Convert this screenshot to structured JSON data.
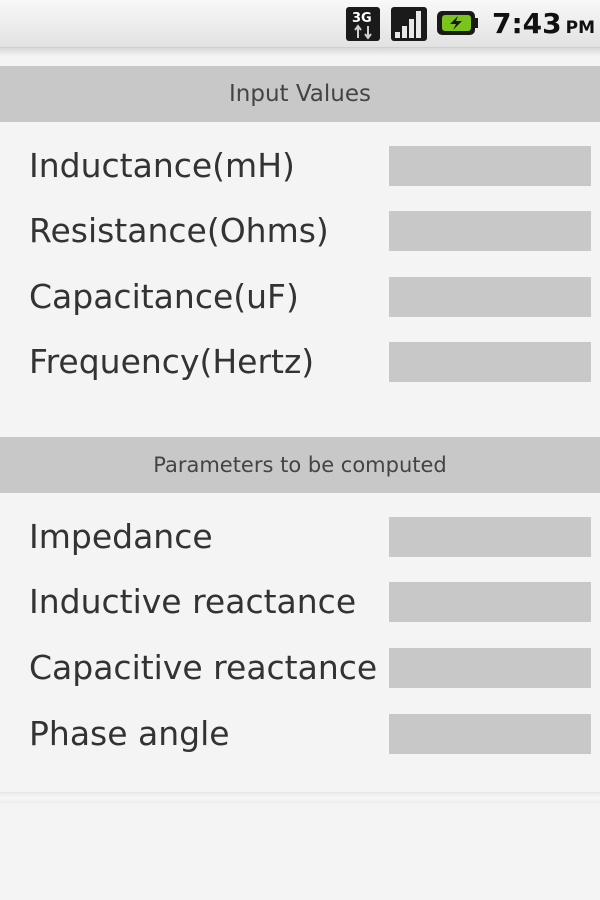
{
  "status_bar": {
    "network_icon": "3g-data-icon",
    "network_label": "3G",
    "signal_icon": "signal-strength-icon",
    "battery_icon": "battery-charging-icon",
    "time": "7:43",
    "ampm": "PM"
  },
  "input_section": {
    "title": "Input Values",
    "fields": [
      {
        "label": "Inductance(mH)",
        "value": ""
      },
      {
        "label": "Resistance(Ohms)",
        "value": ""
      },
      {
        "label": "Capacitance(uF)",
        "value": ""
      },
      {
        "label": "Frequency(Hertz)",
        "value": ""
      }
    ]
  },
  "output_section": {
    "title": "Parameters to be computed",
    "fields": [
      {
        "label": "Impedance",
        "value": ""
      },
      {
        "label": "Inductive reactance",
        "value": ""
      },
      {
        "label": "Capacitive reactance",
        "value": ""
      },
      {
        "label": "Phase angle",
        "value": ""
      }
    ]
  },
  "colors": {
    "background": "#f4f4f4",
    "header_bar": "#c8c8c8",
    "field": "#c8c8c8",
    "text": "#333333",
    "battery_accent": "#7ac41c"
  }
}
